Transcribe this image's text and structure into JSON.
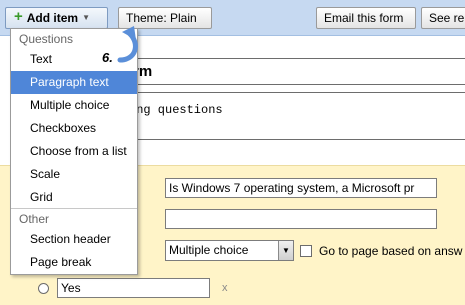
{
  "toolbar": {
    "add_item_label": "Add item",
    "theme_label": "Theme:  Plain",
    "email_label": "Email this form",
    "see_label": "See re"
  },
  "menu": {
    "questions_header": "Questions",
    "question_items": [
      {
        "label": "Text"
      },
      {
        "label": "Paragraph text"
      },
      {
        "label": "Multiple choice"
      },
      {
        "label": "Checkboxes"
      },
      {
        "label": "Choose from a list"
      },
      {
        "label": "Scale"
      },
      {
        "label": "Grid"
      }
    ],
    "other_header": "Other",
    "other_items": [
      {
        "label": "Section header"
      },
      {
        "label": "Page break"
      }
    ],
    "selected_item": "Paragraph text"
  },
  "annotation": {
    "step": "6."
  },
  "form": {
    "title_visible": "rm",
    "description_visible": "ing questions"
  },
  "question_editor": {
    "question_title_value": "Is Windows 7 operating system, a Microsoft pr",
    "help_text_value": "",
    "question_type": "Multiple choice",
    "go_to_page_label": "Go to page based on answ",
    "option_value": "Yes",
    "remove_glyph": "x"
  },
  "colors": {
    "toolbar_bg": "#c6d9f1",
    "menu_selected": "#4f86d8",
    "edit_panel_bg": "#fff4c8",
    "arrow_color": "#5b8fd9"
  }
}
